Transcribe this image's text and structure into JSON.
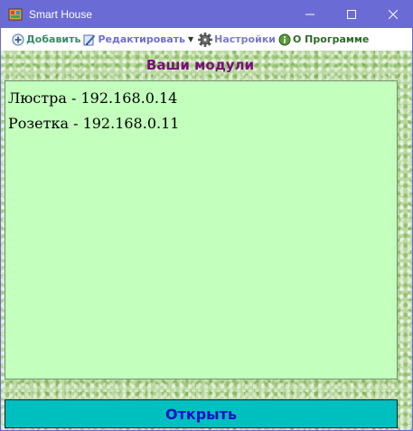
{
  "window": {
    "title": "Smart House",
    "icon": "app-logo-icon",
    "controls": [
      "minimize-icon",
      "maximize-icon",
      "close-icon"
    ]
  },
  "menu": {
    "add": {
      "label": "Добавить",
      "icon": "plus-circle-icon"
    },
    "edit": {
      "label": "Редактировать",
      "icon": "edit-pencil-icon",
      "has_dropdown": true
    },
    "settings": {
      "label": "Настройки",
      "icon": "gear-icon"
    },
    "about": {
      "label": "О Программе",
      "icon": "info-circle-icon"
    }
  },
  "main": {
    "heading": "Ваши модули",
    "modules": [
      "Люстра - 192.168.0.14",
      "Розетка - 192.168.0.11"
    ],
    "open_button_label": "Открыть"
  },
  "colors": {
    "titlebar": "#6b6bd6",
    "list_background": "#c3ffbd",
    "heading": "#7a0f7a",
    "button_background": "#00bfbf",
    "button_text": "#1010c8"
  }
}
